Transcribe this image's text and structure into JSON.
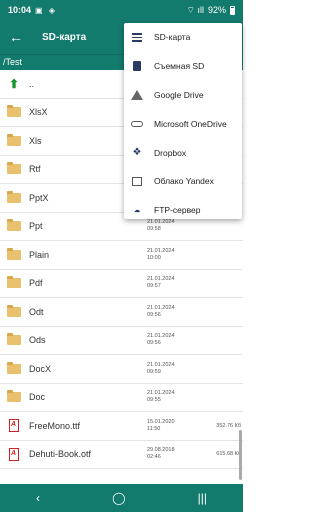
{
  "status_bar": {
    "time": "10:04",
    "icons": "▣ ◈",
    "signal": "⌔ ıll",
    "battery": "92%"
  },
  "app_bar": {
    "back": "←",
    "title": "SD-карта"
  },
  "path": "/Test",
  "parent_label": "..",
  "files": [
    {
      "name": "XlsX",
      "type": "folder",
      "date": "",
      "time": "",
      "size": ""
    },
    {
      "name": "Xls",
      "type": "folder",
      "date": "",
      "time": "",
      "size": ""
    },
    {
      "name": "Rtf",
      "type": "folder",
      "date": "",
      "time": "",
      "size": ""
    },
    {
      "name": "PptX",
      "type": "folder",
      "date": "",
      "time": "",
      "size": ""
    },
    {
      "name": "Ppt",
      "type": "folder",
      "date": "21.01.2024",
      "time": "09:58",
      "size": ""
    },
    {
      "name": "Plain",
      "type": "folder",
      "date": "21.01.2024",
      "time": "10:00",
      "size": ""
    },
    {
      "name": "Pdf",
      "type": "folder",
      "date": "21.01.2024",
      "time": "09:57",
      "size": ""
    },
    {
      "name": "Odt",
      "type": "folder",
      "date": "21.01.2024",
      "time": "09:56",
      "size": ""
    },
    {
      "name": "Ods",
      "type": "folder",
      "date": "21.01.2024",
      "time": "09:56",
      "size": ""
    },
    {
      "name": "DocX",
      "type": "folder",
      "date": "21.01.2024",
      "time": "09:59",
      "size": ""
    },
    {
      "name": "Doc",
      "type": "folder",
      "date": "21.01.2024",
      "time": "09:55",
      "size": ""
    },
    {
      "name": "FreeMono.ttf",
      "type": "pdf",
      "date": "15.01.2020",
      "time": "11:50",
      "size": "352.76 Кб"
    },
    {
      "name": "Dehuti-Book.otf",
      "type": "pdf",
      "date": "29.08.2018",
      "time": "02:46",
      "size": "615.68 Кб"
    }
  ],
  "menu": [
    {
      "label": "SD-карта",
      "icon": "sd-card-icon"
    },
    {
      "label": "Съемная SD",
      "icon": "removable-sd-icon"
    },
    {
      "label": "Google Drive",
      "icon": "google-drive-icon"
    },
    {
      "label": "Microsoft OneDrive",
      "icon": "onedrive-icon"
    },
    {
      "label": "Dropbox",
      "icon": "dropbox-icon"
    },
    {
      "label": "Облако Yandex",
      "icon": "yandex-cloud-icon"
    },
    {
      "label": "FTP-сервер",
      "icon": "ftp-server-icon"
    }
  ],
  "nav": {
    "back": "‹",
    "home": "◯",
    "recents": "|||"
  }
}
